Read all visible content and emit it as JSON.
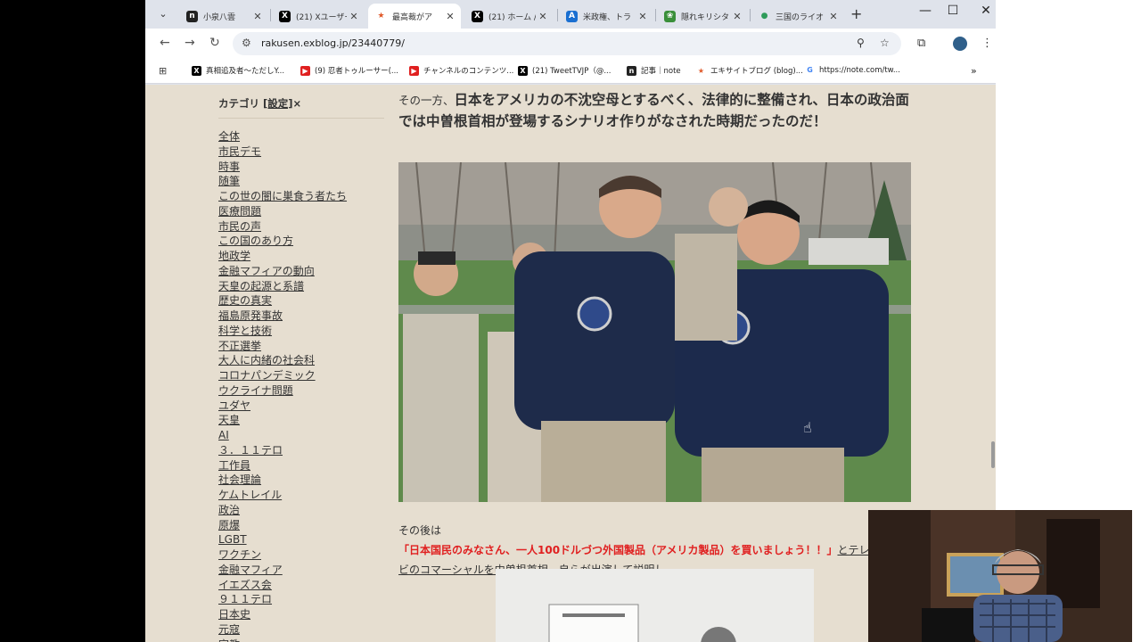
{
  "tabs": [
    {
      "label": "小泉八雲",
      "favicon": "n",
      "color": "#222222"
    },
    {
      "label": "(21) Xユーザー",
      "favicon": "X",
      "color": "#000000"
    },
    {
      "label": "最高裁がア",
      "favicon": "★",
      "color": "#e05a2b"
    },
    {
      "label": "(21) ホーム /",
      "favicon": "X",
      "color": "#000000"
    },
    {
      "label": "米政権、トラ",
      "favicon": "A",
      "color": "#1a6fd1"
    },
    {
      "label": "隠れキリシタ",
      "favicon": "❀",
      "color": "#3a8f3a"
    },
    {
      "label": "三国のライオ",
      "favicon": "●",
      "color": "#2e9b5a"
    }
  ],
  "url": "rakusen.exblog.jp/23440779/",
  "bookmarks": [
    {
      "label": "真相追及者〜ただしY...",
      "icon": "X",
      "color": "#000000"
    },
    {
      "label": "(9) 忍者トゥルーサー(...",
      "icon": "▶",
      "color": "#e02020"
    },
    {
      "label": "チャンネルのコンテンツ...",
      "icon": "▶",
      "color": "#e02020"
    },
    {
      "label": "(21) TweetTVJP（@...",
      "icon": "X",
      "color": "#000000"
    },
    {
      "label": "記事｜note",
      "icon": "n",
      "color": "#222222"
    },
    {
      "label": "エキサイトブログ (blog)...",
      "icon": "★",
      "color": "#e05a2b"
    },
    {
      "label": "https://note.com/tw...",
      "icon": "G",
      "color": "#4285f4"
    }
  ],
  "sidebar": {
    "title": "カテゴリ",
    "settings": "[設定]",
    "close": "×",
    "categories": [
      "全体",
      "市民デモ",
      "時事",
      "随筆",
      "この世の闇に巣食う者たち",
      "医療問題",
      "市民の声",
      "この国のあり方",
      "地政学",
      "金融マフィアの動向",
      "天皇の起源と系譜",
      "歴史の真実",
      "福島原発事故",
      "科学と技術",
      "不正選挙",
      "大人に内緒の社会科",
      "コロナパンデミック",
      "ウクライナ問題",
      "ユダヤ",
      "天皇",
      "AI",
      "３．１１テロ",
      "工作員",
      "社会理論",
      "ケムトレイル",
      "政治",
      "原爆",
      "LGBT",
      "ワクチン",
      "金融マフィア",
      "イエズス会",
      "９１１テロ",
      "日本史",
      "元寇",
      "宗教"
    ]
  },
  "article": {
    "lead": "その一方、",
    "heading": "日本をアメリカの不沈空母とするべく、法律的に整備され、日本の政治面では中曽根首相が登場するシナリオ作りがなされた時期だったのだ！",
    "para_prefix": "その後は",
    "para_red": "「日本国民のみなさん、一人100ドルづつ外国製品（アメリカ製品）を買いましょう！！」",
    "para_suffix": "とテレビのコマーシャルを中曽根首相、自らが出演して説明し、"
  }
}
